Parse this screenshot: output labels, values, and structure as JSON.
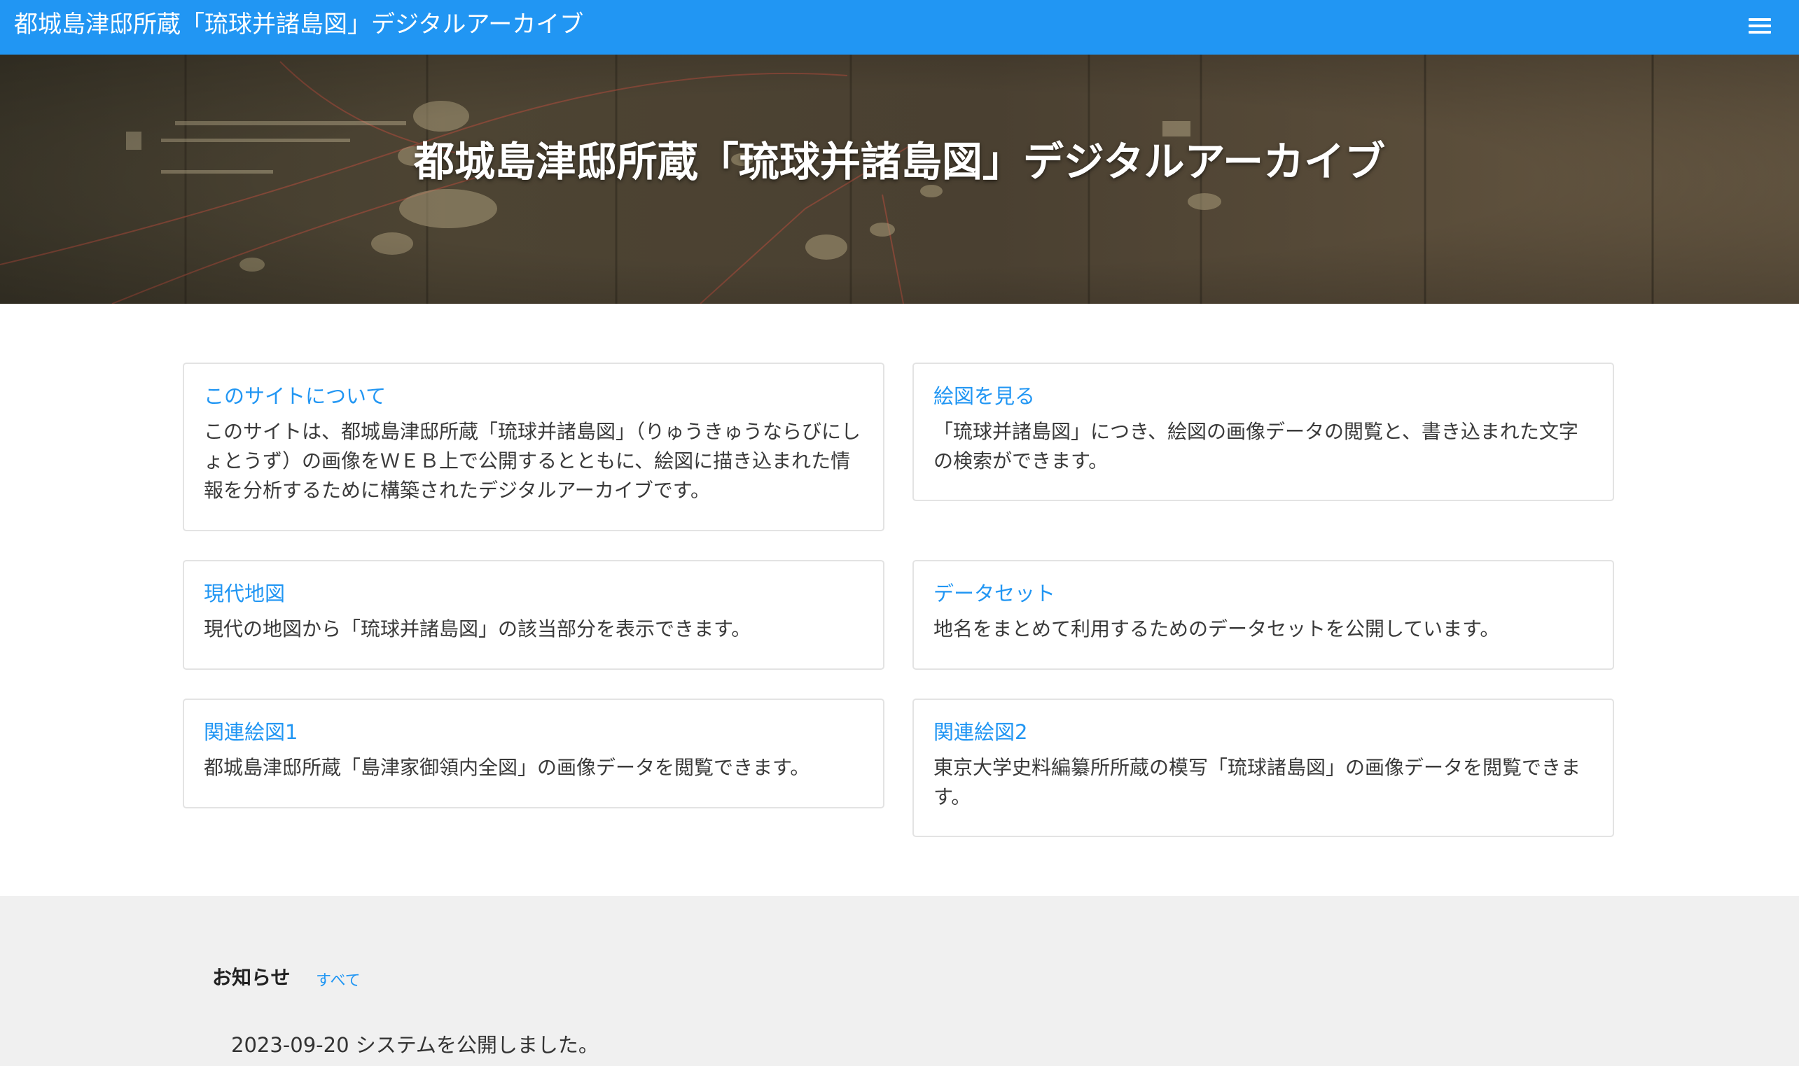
{
  "header": {
    "title": "都城島津邸所蔵「琉球并諸島図」デジタルアーカイブ",
    "menu_icon": "hamburger-menu-icon",
    "color": "#2196f3"
  },
  "hero": {
    "title": "都城島津邸所蔵「琉球并諸島図」デジタルアーカイブ"
  },
  "cards": [
    {
      "link": "このサイトについて",
      "text": "このサイトは、都城島津邸所蔵「琉球并諸島図」（りゅうきゅうならびにしょとうず）の画像をＷＥＢ上で公開するとともに、絵図に描き込まれた情報を分析するために構築されたデジタルアーカイブです。"
    },
    {
      "link": "絵図を見る",
      "text": "「琉球并諸島図」につき、絵図の画像データの閲覧と、書き込まれた文字の検索ができます。"
    },
    {
      "link": "現代地図",
      "text": "現代の地図から「琉球并諸島図」の該当部分を表示できます。"
    },
    {
      "link": "データセット",
      "text": "地名をまとめて利用するためのデータセットを公開しています。"
    },
    {
      "link": "関連絵図1",
      "text": "都城島津邸所蔵「島津家御領内全図」の画像データを閲覧できます。"
    },
    {
      "link": "関連絵図2",
      "text": "東京大学史料編纂所所蔵の模写「琉球諸島図」の画像データを閲覧できます。"
    }
  ],
  "news": {
    "heading": "お知らせ",
    "all_link": "すべて",
    "items": [
      {
        "text": "2023-09-20 システムを公開しました。"
      }
    ]
  },
  "colors": {
    "accent": "#2196f3",
    "footer_bg": "#f0f0f0"
  }
}
